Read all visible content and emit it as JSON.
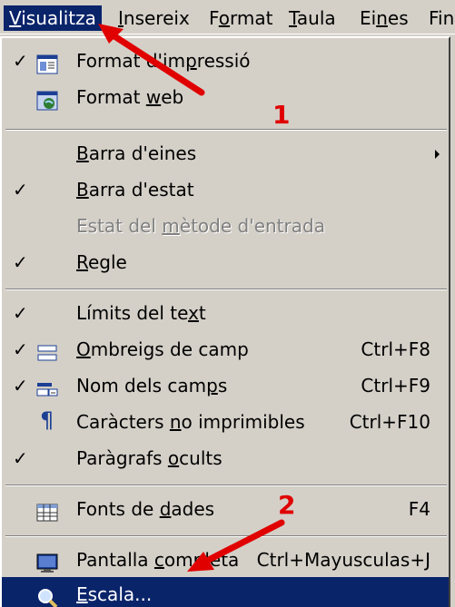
{
  "menubar": {
    "items": [
      {
        "label": "Visualitza"
      },
      {
        "label": "Insereix"
      },
      {
        "label": "Format"
      },
      {
        "label": "Taula"
      },
      {
        "label": "Eines"
      },
      {
        "label": "Fine"
      }
    ]
  },
  "menu": {
    "items": [
      {
        "label": "Format d'impressió",
        "checked": "✓",
        "icon": "print-layout-icon"
      },
      {
        "label": "Format web",
        "checked": "",
        "icon": "web-layout-icon"
      },
      {
        "label": "Barra d'eines",
        "checked": "",
        "submenu": true
      },
      {
        "label": "Barra d'estat",
        "checked": "✓"
      },
      {
        "label": "Estat del mètode d'entrada",
        "checked": "",
        "disabled": true
      },
      {
        "label": "Regle",
        "checked": "✓"
      },
      {
        "label": "Límits del text",
        "checked": "✓"
      },
      {
        "label": "Ombreigs de camp",
        "checked": "✓",
        "shortcut": "Ctrl+F8",
        "icon": "field-shading-icon"
      },
      {
        "label": "Nom dels camps",
        "checked": "✓",
        "shortcut": "Ctrl+F9",
        "icon": "field-names-icon"
      },
      {
        "label": "Caràcters no imprimibles",
        "checked": "",
        "shortcut": "Ctrl+F10",
        "icon": "pilcrow-icon"
      },
      {
        "label": "Paràgrafs ocults",
        "checked": "✓"
      },
      {
        "label": "Fonts de dades",
        "checked": "",
        "shortcut": "F4",
        "icon": "data-sources-icon"
      },
      {
        "label": "Pantalla completa",
        "checked": "",
        "shortcut": "Ctrl+Mayusculas+J",
        "icon": "full-screen-icon"
      },
      {
        "label": "Escala...",
        "checked": "",
        "icon": "zoom-magnifier-icon",
        "highlighted": true
      }
    ]
  },
  "annotations": {
    "step1": "1",
    "step2": "2"
  },
  "colors": {
    "menu_bg": "#d4d0c8",
    "highlight": "#0a246a",
    "annotation": "#e00000"
  }
}
